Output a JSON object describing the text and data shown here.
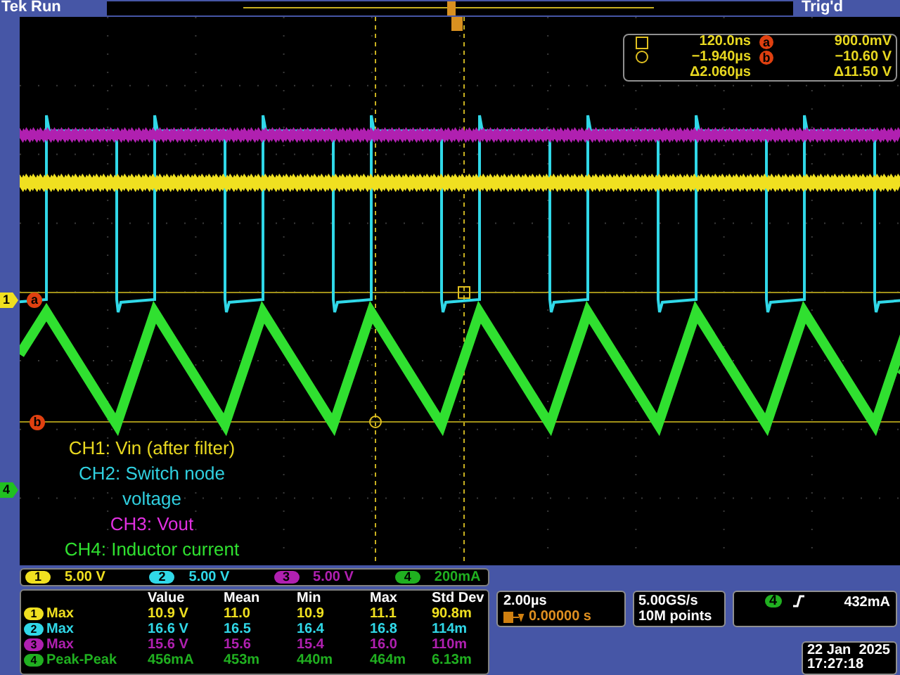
{
  "top_bar": {
    "brand": "Tek",
    "acquisition_state": "Run",
    "trigger_status": "Trig'd"
  },
  "cursor_readout": {
    "rows": [
      {
        "kind": "square",
        "time": "120.0ns",
        "marker": "a",
        "value": "900.0mV"
      },
      {
        "kind": "circle",
        "time": "−1.940µs",
        "marker": "b",
        "value": "−10.60 V"
      },
      {
        "kind": "delta",
        "time": "Δ2.060µs",
        "value": "Δ11.50 V"
      }
    ]
  },
  "graticule": {
    "channel_markers": [
      {
        "label": "1",
        "color": "#f0e020"
      },
      {
        "label": "4",
        "color": "#20c020"
      }
    ],
    "cursor_labels": [
      "a",
      "b"
    ]
  },
  "legend": [
    {
      "text": "CH1: Vin (after filter)",
      "color": "#e8d820"
    },
    {
      "text": "CH2: Switch node voltage",
      "color": "#30d0e0"
    },
    {
      "text": "CH3: Vout",
      "color": "#e030e0"
    },
    {
      "text": "CH4: Inductor current",
      "color": "#30e030"
    }
  ],
  "channels": [
    {
      "number": "1",
      "scale": "5.00 V",
      "color": "#f0e020"
    },
    {
      "number": "2",
      "scale": "5.00 V",
      "color": "#30d8e8"
    },
    {
      "number": "3",
      "scale": "5.00 V",
      "color": "#b020b0"
    },
    {
      "number": "4",
      "scale": "200mA",
      "color": "#20b020"
    }
  ],
  "measurements": {
    "columns": [
      "Value",
      "Mean",
      "Min",
      "Max",
      "Std Dev"
    ],
    "rows": [
      {
        "channel": "1",
        "type": "Max",
        "color": "#f0e020",
        "values": [
          "10.9 V",
          "11.0",
          "10.9",
          "11.1",
          "90.8m"
        ]
      },
      {
        "channel": "2",
        "type": "Max",
        "color": "#30d8e8",
        "values": [
          "16.6 V",
          "16.5",
          "16.4",
          "16.8",
          "114m"
        ]
      },
      {
        "channel": "3",
        "type": "Max",
        "color": "#b020b0",
        "values": [
          "15.6 V",
          "15.6",
          "15.4",
          "16.0",
          "110m"
        ]
      },
      {
        "channel": "4",
        "type": "Peak-Peak",
        "color": "#20b020",
        "values": [
          "456mA",
          "453m",
          "440m",
          "464m",
          "6.13m"
        ]
      }
    ]
  },
  "horizontal": {
    "scale": "2.00µs",
    "position": "0.00000 s"
  },
  "acquisition": {
    "sample_rate": "5.00GS/s",
    "record_length": "10M points"
  },
  "trigger": {
    "channel": "4",
    "level": "432mA"
  },
  "clock": {
    "date": "22 Jan  2025",
    "time": "17:27:18"
  }
}
